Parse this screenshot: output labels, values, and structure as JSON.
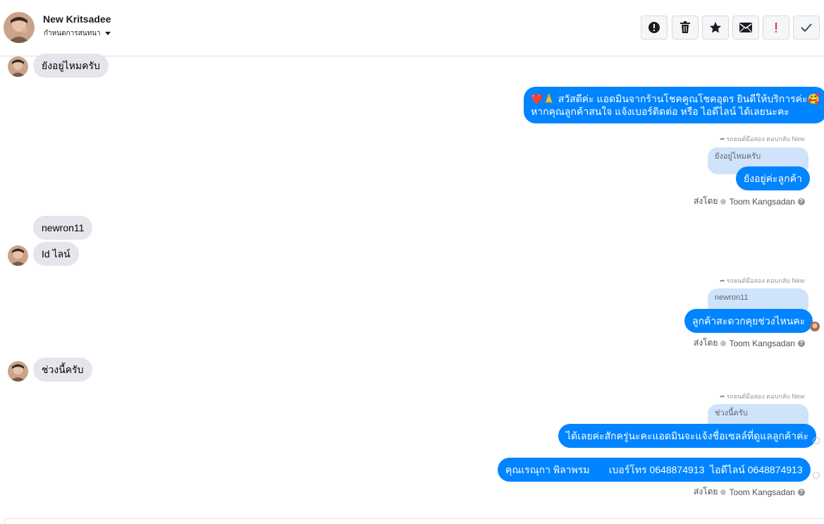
{
  "header": {
    "contact_name": "New Kritsadee",
    "subtitle": "กำหนดการสนทนา",
    "toolbar": [
      {
        "icon": "exclamation-circle-icon"
      },
      {
        "icon": "trash-icon"
      },
      {
        "icon": "star-icon"
      },
      {
        "icon": "envelope-icon"
      },
      {
        "icon": "exclamation-red-icon",
        "color": "#e0245e"
      },
      {
        "icon": "checkmark-icon"
      }
    ]
  },
  "messages": {
    "m1": "ยังอยู่ไหมครับ",
    "m2_line1": "❤️🙏 สวัสดีค่ะ แอดมินจากร้านโชคคูณโชคอุดร ยินดีให้บริการค่ะ🥰",
    "m2_line2": "หากคุณลูกค้าสนใจ แจ้งเบอร์ติดต่อ หรือ ไอดีไลน์ ได้เลยนะคะ",
    "r1_meta": "รถยนต์มือสอง ตอบกลับ New",
    "r1_quote": "ยังอยู่ไหมครับ",
    "r1_reply": "ยังอยู่ค่ะลูกค้า",
    "sent_by_1_label": "ส่งโดย",
    "sent_by_1_name": "Toom Kangsadan",
    "m3": "newron11",
    "m4": "Id ไลน์",
    "r2_meta": "รถยนต์มือสอง ตอบกลับ New",
    "r2_quote": "newron11",
    "r2_reply": "ลูกค้าสะดวกคุยช่วงไหนคะ",
    "sent_by_2_label": "ส่งโดย",
    "sent_by_2_name": "Toom Kangsadan",
    "m5": "ช่วงนี้ครับ",
    "r3_meta": "รถยนต์มือสอง ตอบกลับ New",
    "r3_quote": "ช่วงนี้ครับ",
    "r3_reply": "ได้เลยค่ะสักครู่นะคะแอดมินจะแจ้งชื่อเซลล์ที่ดูแลลูกค้าค่ะ",
    "m6": "คุณเรณุกา พิลาพรม       เบอร์โทร 0648874913  ไอดีไลน์ 0648874913",
    "sent_by_3_label": "ส่งโดย",
    "sent_by_3_name": "Toom Kangsadan"
  },
  "colors": {
    "outgoing_bubble": "#0084ff",
    "incoming_bubble": "#e4e6eb",
    "quote_bubble": "#cfe3fb"
  }
}
